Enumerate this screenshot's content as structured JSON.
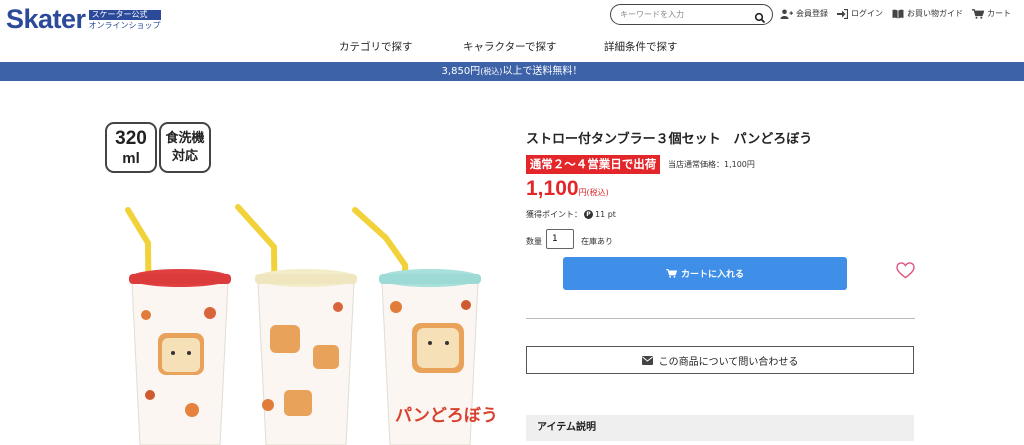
{
  "header": {
    "logo_word": "Skater",
    "logo_tag1": "スケーター公式",
    "logo_tag2": "オンラインショップ",
    "search_placeholder": "キーワードを入力",
    "links": {
      "register": "会員登録",
      "login": "ログイン",
      "guide": "お買い物ガイド",
      "cart": "カート"
    }
  },
  "nav": {
    "category": "カテゴリで探す",
    "character": "キャラクターで探す",
    "detail": "詳細条件で探す"
  },
  "banner": {
    "price": "3,850円",
    "tax": "(税込)",
    "text": "以上で送料無料！"
  },
  "badges": {
    "capacity_value": "320",
    "capacity_unit": "ml",
    "dishwasher_line1": "食洗機",
    "dishwasher_line2": "対応"
  },
  "product": {
    "title": "ストロー付タンブラー３個セット　パンどろぼう",
    "shipping_badge": "通常２〜４営業日で出荷",
    "regular_price": "当店通常価格：1,100円",
    "price": "1,100",
    "price_unit": "円(税込)",
    "points_label": "獲得ポイント：",
    "points_icon": "P",
    "points_value": "11 pt",
    "qty_label": "数量",
    "qty_value": "1",
    "stock": "在庫あり",
    "cart_button": "カートに入れる",
    "inquiry_button": "この商品について問い合わせる",
    "item_desc_heading": "アイテム説明",
    "cup_text": "パンどろぼう"
  },
  "colors": {
    "brand": "#2b4a9a",
    "banner": "#3e62a8",
    "accent_red": "#e3262a",
    "cart_blue": "#3f8ee8",
    "heart": "#e0507a"
  }
}
